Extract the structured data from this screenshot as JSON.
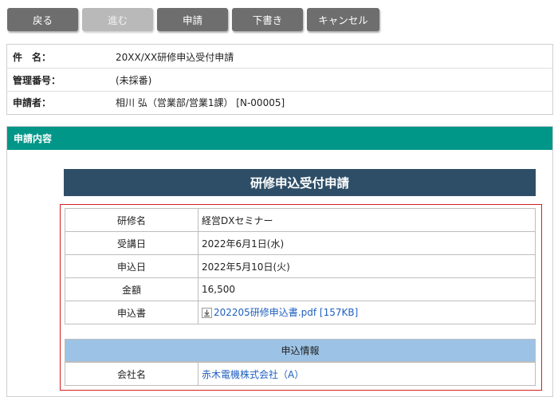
{
  "toolbar": {
    "back_label": "戻る",
    "forward_label": "進む",
    "submit_label": "申請",
    "draft_label": "下書き",
    "cancel_label": "キャンセル"
  },
  "header_info": {
    "subject_label": "件　名：",
    "subject_value": "20XX/XX研修申込受付申請",
    "mgmt_no_label": "管理番号：",
    "mgmt_no_value": "(未採番)",
    "applicant_label": "申請者：",
    "applicant_value": "相川 弘（営業部/営業1課） [N-00005]"
  },
  "section": {
    "title": "申請内容"
  },
  "form": {
    "title": "研修申込受付申請",
    "rows": [
      {
        "label": "研修名",
        "value": "経営DXセミナー"
      },
      {
        "label": "受講日",
        "value": "2022年6月1日(水)"
      },
      {
        "label": "申込日",
        "value": "2022年5月10日(火)"
      },
      {
        "label": "金額",
        "value": "16,500"
      }
    ],
    "attachment_label": "申込書",
    "attachment_file": "202205研修申込書.pdf [157KB]",
    "subsection_title": "申込情報",
    "company_label": "会社名",
    "company_value": "赤木電機株式会社（A）"
  },
  "colors": {
    "toolbar_button": "#6e6e6e",
    "toolbar_disabled": "#b9b9b9",
    "section_bar": "#009688",
    "form_title": "#2e4e68",
    "subsection": "#9cc3e6",
    "highlight_border": "#d42020",
    "link": "#1f5fbf"
  }
}
